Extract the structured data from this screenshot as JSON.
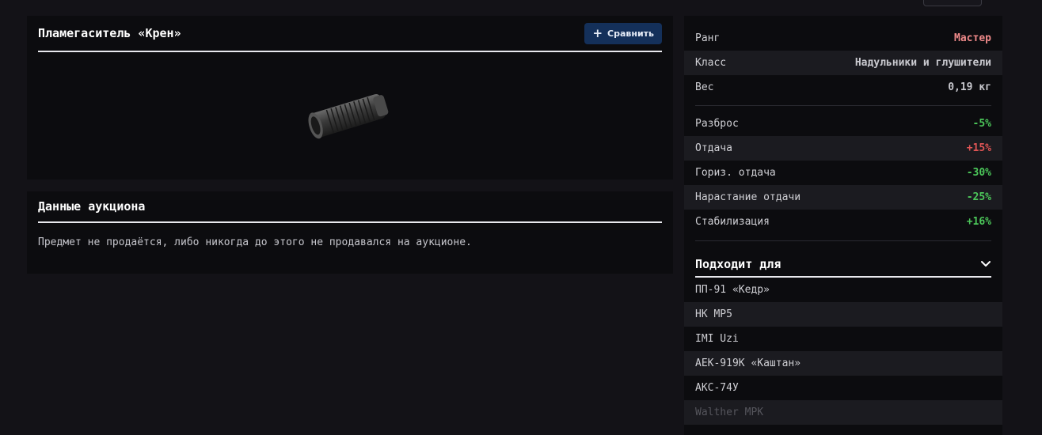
{
  "item": {
    "title": "Пламегаситель «Крен»",
    "compare_label": "Сравнить",
    "image_icon": "flash-hider-image"
  },
  "auction": {
    "title": "Данные аукциона",
    "text": "Предмет не продаётся, либо никогда до этого не продавался на аукционе."
  },
  "info": [
    {
      "label": "Ранг",
      "value": "Мастер",
      "tone": "rank"
    },
    {
      "label": "Класс",
      "value": "Надульники и глушители",
      "tone": "default"
    },
    {
      "label": "Вес",
      "value": "0,19 кг",
      "tone": "default"
    }
  ],
  "stats": [
    {
      "label": "Разброс",
      "value": "-5%",
      "tone": "good"
    },
    {
      "label": "Отдача",
      "value": "+15%",
      "tone": "bad"
    },
    {
      "label": "Гориз. отдача",
      "value": "-30%",
      "tone": "good"
    },
    {
      "label": "Нарастание отдачи",
      "value": "-25%",
      "tone": "good"
    },
    {
      "label": "Стабилизация",
      "value": "+16%",
      "tone": "good"
    }
  ],
  "fits": {
    "title": "Подходит для",
    "weapons": [
      "ПП-91 «Кедр»",
      "HK MP5",
      "IMI Uzi",
      "АЕК-919К «Каштан»",
      "АКС-74У",
      "Walther MPK"
    ]
  },
  "colors": {
    "rank": "#f08a8a",
    "good": "#4cc85a",
    "bad": "#e05555",
    "accent_button": "#14305a"
  }
}
